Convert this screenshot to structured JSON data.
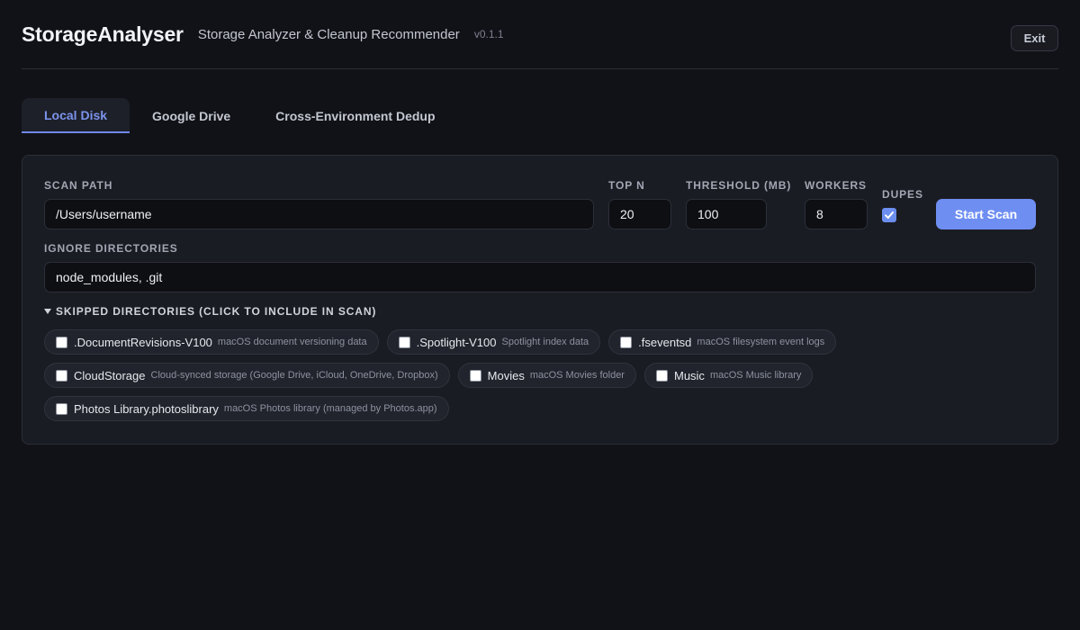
{
  "header": {
    "brand": "StorageAnalyser",
    "subtitle": "Storage Analyzer & Cleanup Recommender",
    "version": "v0.1.1",
    "exit_label": "Exit"
  },
  "tabs": [
    {
      "label": "Local Disk",
      "active": true
    },
    {
      "label": "Google Drive",
      "active": false
    },
    {
      "label": "Cross-Environment Dedup",
      "active": false
    }
  ],
  "form": {
    "scan_path": {
      "label": "SCAN PATH",
      "value": "/Users/username"
    },
    "top_n": {
      "label": "TOP N",
      "value": "20"
    },
    "threshold": {
      "label": "THRESHOLD (MB)",
      "value": "100"
    },
    "workers": {
      "label": "WORKERS",
      "value": "8"
    },
    "dupes": {
      "label": "DUPES",
      "checked": true
    },
    "start_label": "Start Scan",
    "ignore": {
      "label": "IGNORE DIRECTORIES",
      "value": "node_modules, .git"
    }
  },
  "skipped": {
    "summary": "SKIPPED DIRECTORIES (CLICK TO INCLUDE IN SCAN)",
    "items": [
      {
        "name": ".DocumentRevisions-V100",
        "desc": "macOS document versioning data",
        "checked": false
      },
      {
        "name": ".Spotlight-V100",
        "desc": "Spotlight index data",
        "checked": false
      },
      {
        "name": ".fseventsd",
        "desc": "macOS filesystem event logs",
        "checked": false
      },
      {
        "name": "CloudStorage",
        "desc": "Cloud-synced storage (Google Drive, iCloud, OneDrive, Dropbox)",
        "checked": false
      },
      {
        "name": "Movies",
        "desc": "macOS Movies folder",
        "checked": false
      },
      {
        "name": "Music",
        "desc": "macOS Music library",
        "checked": false
      },
      {
        "name": "Photos Library.photoslibrary",
        "desc": "macOS Photos library (managed by Photos.app)",
        "checked": false
      }
    ]
  },
  "colors": {
    "background": "#111217",
    "panel": "#1a1c23",
    "accent": "#6e8ef2",
    "active_tab_text": "#7c93ec"
  }
}
